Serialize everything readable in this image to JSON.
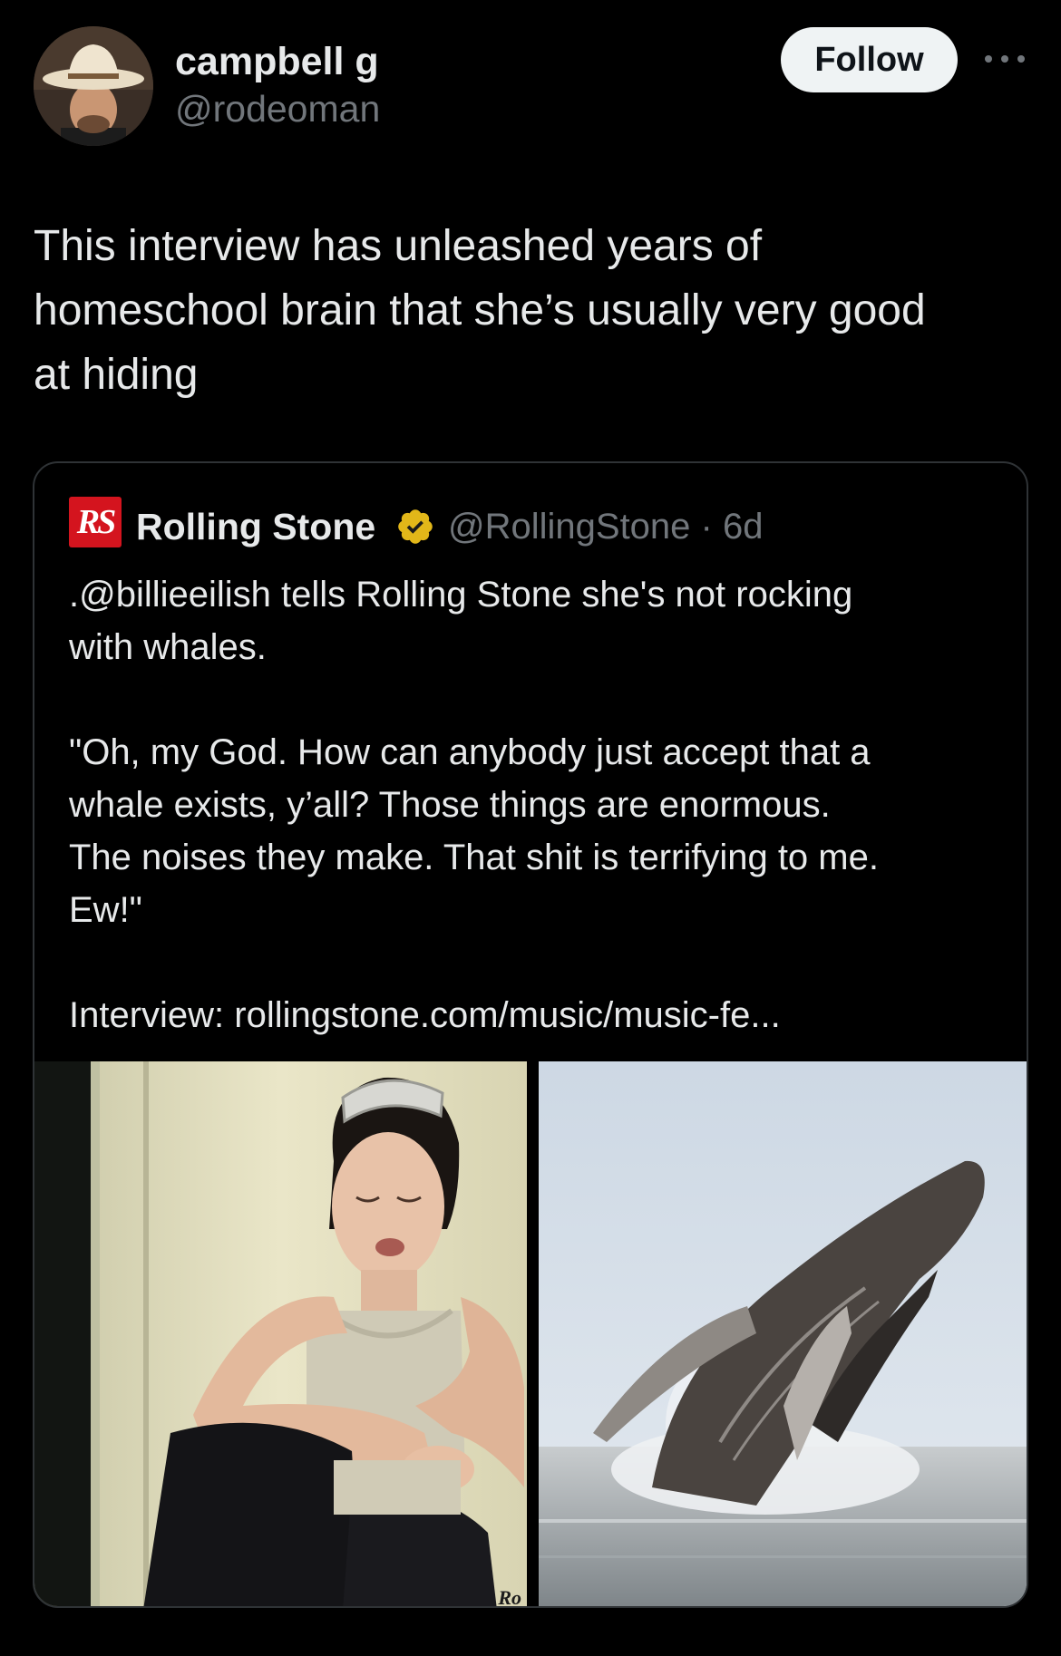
{
  "author": {
    "display_name": "campbell g",
    "handle": "@rodeoman",
    "follow_label": "Follow"
  },
  "tweet": {
    "text": "This interview has unleashed years of\nhomeschool brain that she’s usually very good\nat hiding"
  },
  "quoted_tweet": {
    "logo_text": "RS",
    "display_name": "Rolling Stone",
    "verified_icon": "gold-verified-badge-icon",
    "handle_and_time": "@RollingStone · 6d",
    "text": ".@billieeilish tells Rolling Stone she's not rocking\nwith whales.\n\n\"Oh, my God. How can anybody just accept that a\nwhale exists, y’all? Those things are enormous.\nThe noises they make. That shit is terrifying to me.\nEw!\"\n\nInterview: rollingstone.com/music/music-fe...",
    "image_watermark": "Ro",
    "media": [
      {
        "subject": "woman-sitting-against-wall-photo"
      },
      {
        "subject": "humpback-whale-breaching-photo"
      }
    ]
  },
  "colors": {
    "background": "#000000",
    "primary_text": "#e7e9ea",
    "secondary_text": "#71767b",
    "border": "#2f3336",
    "follow_bg": "#eff3f4",
    "rs_red": "#d4141e",
    "verified_gold": "#e2b719"
  }
}
